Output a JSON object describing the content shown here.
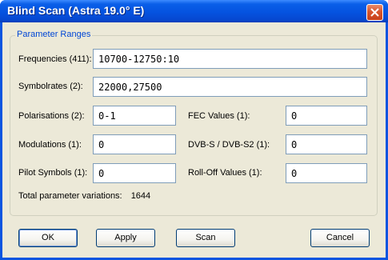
{
  "window": {
    "title": "Blind Scan (Astra 19.0° E)"
  },
  "group": {
    "legend": "Parameter Ranges"
  },
  "fields": {
    "frequencies": {
      "label": "Frequencies (411):",
      "value": "10700-12750:10"
    },
    "symbolrates": {
      "label": "Symbolrates (2):",
      "value": "22000,27500"
    },
    "polarisations": {
      "label": "Polarisations (2):",
      "value": "0-1"
    },
    "fec_values": {
      "label": "FEC Values (1):",
      "value": "0"
    },
    "modulations": {
      "label": "Modulations (1):",
      "value": "0"
    },
    "dvbs": {
      "label": "DVB-S / DVB-S2 (1):",
      "value": "0"
    },
    "pilot_symbols": {
      "label": "Pilot Symbols (1):",
      "value": "0"
    },
    "rolloff": {
      "label": "Roll-Off Values (1):",
      "value": "0"
    }
  },
  "total": {
    "label": "Total parameter variations:",
    "value": "1644"
  },
  "buttons": {
    "ok": "OK",
    "apply": "Apply",
    "scan": "Scan",
    "cancel": "Cancel"
  },
  "icons": {
    "close": "close-icon"
  },
  "colors": {
    "titlebar": "#0553e0",
    "face": "#ece9d8",
    "legend": "#0046d5",
    "close": "#d8562e"
  }
}
